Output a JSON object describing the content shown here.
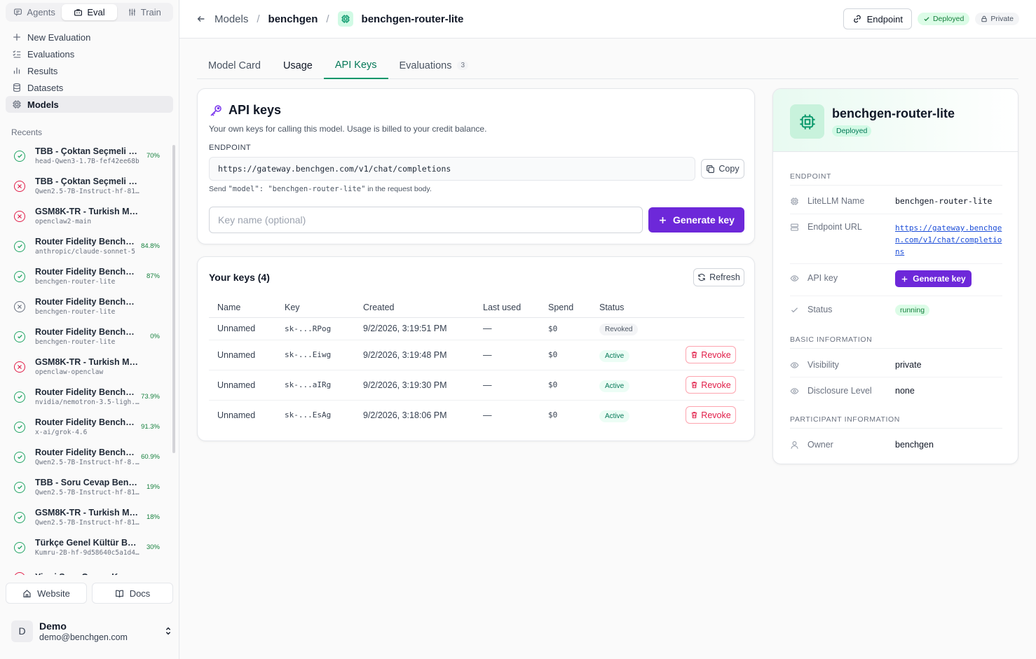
{
  "sidebar": {
    "modes": [
      {
        "label": "Agents",
        "icon": "chat-icon"
      },
      {
        "label": "Eval",
        "icon": "briefcase-icon",
        "active": true
      },
      {
        "label": "Train",
        "icon": "sliders-icon"
      }
    ],
    "nav": [
      {
        "label": "New Evaluation",
        "icon": "plus-icon"
      },
      {
        "label": "Evaluations",
        "icon": "list-check-icon"
      },
      {
        "label": "Results",
        "icon": "bar-chart-icon"
      },
      {
        "label": "Datasets",
        "icon": "database-icon"
      },
      {
        "label": "Models",
        "icon": "chip-icon",
        "active": true
      }
    ],
    "recents_title": "Recents",
    "recents": [
      {
        "name": "TBB - Çoktan Seçmeli Be...",
        "sub": "head-Qwen3-1.7B-fef42ee68b",
        "score": "70%",
        "status": "success"
      },
      {
        "name": "TBB - Çoktan Seçmeli Benchm...",
        "sub": "Qwen2.5-7B-Instruct-hf-8116f9e5...",
        "score": "",
        "status": "error"
      },
      {
        "name": "GSM8K-TR - Turkish Math Rea...",
        "sub": "openclaw2-main",
        "score": "",
        "status": "error"
      },
      {
        "name": "Router Fidelity Benchm...",
        "sub": "anthropic/claude-sonnet-5",
        "score": "84.8%",
        "status": "success"
      },
      {
        "name": "Router Fidelity Benchmark",
        "sub": "benchgen-router-lite",
        "score": "87%",
        "status": "success"
      },
      {
        "name": "Router Fidelity Benchmark",
        "sub": "benchgen-router-lite",
        "score": "",
        "status": "cancel"
      },
      {
        "name": "Router Fidelity Benchmark",
        "sub": "benchgen-router-lite",
        "score": "0%",
        "status": "success"
      },
      {
        "name": "GSM8K-TR - Turkish Math Rea...",
        "sub": "openclaw-openclaw",
        "score": "",
        "status": "error"
      },
      {
        "name": "Router Fidelity Benchm...",
        "sub": "nvidia/nemotron-3.5-ligh...",
        "score": "73.9%",
        "status": "success"
      },
      {
        "name": "Router Fidelity Benchm...",
        "sub": "x-ai/grok-4.6",
        "score": "91.3%",
        "status": "success"
      },
      {
        "name": "Router Fidelity Benchm...",
        "sub": "Qwen2.5-7B-Instruct-hf-8...",
        "score": "60.9%",
        "status": "success"
      },
      {
        "name": "TBB - Soru Cevap Bench...",
        "sub": "Qwen2.5-7B-Instruct-hf-811...",
        "score": "19%",
        "status": "success"
      },
      {
        "name": "GSM8K-TR - Turkish Mat...",
        "sub": "Qwen2.5-7B-Instruct-hf-811...",
        "score": "18%",
        "status": "success"
      },
      {
        "name": "Türkçe Genel Kültür Benc...",
        "sub": "Kumru-2B-hf-9d58640c5a1d4...",
        "score": "30%",
        "status": "success"
      },
      {
        "name": "Yirmi Soru Oyunu Kıyaslaması",
        "sub": "",
        "score": "",
        "status": "error"
      }
    ],
    "website_label": "Website",
    "docs_label": "Docs",
    "user": {
      "initial": "D",
      "name": "Demo",
      "email": "demo@benchgen.com"
    }
  },
  "header": {
    "back_label": "Models",
    "crumb_org": "benchgen",
    "crumb_model": "benchgen-router-lite",
    "endpoint_label": "Endpoint",
    "deployed_label": "Deployed",
    "private_label": "Private"
  },
  "tabs": [
    {
      "label": "Model Card",
      "count": ""
    },
    {
      "label": "Usage",
      "count": ""
    },
    {
      "label": "API Keys",
      "count": "",
      "active": true
    },
    {
      "label": "Evaluations",
      "count": "3"
    }
  ],
  "api_card": {
    "title": "API keys",
    "description": "Your own keys for calling this model. Usage is billed to your credit balance.",
    "endpoint_label": "ENDPOINT",
    "endpoint_url": "https://gateway.benchgen.com/v1/chat/completions",
    "copy_label": "Copy",
    "hint_prefix": "Send ",
    "hint_code": "\"model\": \"benchgen-router-lite\"",
    "hint_suffix": " in the request body.",
    "keyname_placeholder": "Key name (optional)",
    "generate_label": "Generate key"
  },
  "keys_card": {
    "title": "Your keys (4)",
    "refresh_label": "Refresh",
    "columns": [
      "Name",
      "Key",
      "Created",
      "Last used",
      "Spend",
      "Status"
    ],
    "rows": [
      {
        "name": "Unnamed",
        "key": "sk-...RPog",
        "created": "9/2/2026, 3:19:51 PM",
        "last_used": "—",
        "spend": "$0",
        "status": "Revoked",
        "action": ""
      },
      {
        "name": "Unnamed",
        "key": "sk-...Eiwg",
        "created": "9/2/2026, 3:19:48 PM",
        "last_used": "—",
        "spend": "$0",
        "status": "Active",
        "action": "Revoke"
      },
      {
        "name": "Unnamed",
        "key": "sk-...aIRg",
        "created": "9/2/2026, 3:19:30 PM",
        "last_used": "—",
        "spend": "$0",
        "status": "Active",
        "action": "Revoke"
      },
      {
        "name": "Unnamed",
        "key": "sk-...EsAg",
        "created": "9/2/2026, 3:18:06 PM",
        "last_used": "—",
        "spend": "$0",
        "status": "Active",
        "action": "Revoke"
      }
    ]
  },
  "info_card": {
    "title": "benchgen-router-lite",
    "badge": "Deployed",
    "endpoint_section": "ENDPOINT",
    "litellm_label": "LiteLLM Name",
    "litellm_value": "benchgen-router-lite",
    "endpoint_url_label": "Endpoint URL",
    "endpoint_url_value": "https://gateway.benchgen.com/v1/chat/completions",
    "api_key_label": "API key",
    "api_key_button": "Generate key",
    "status_label": "Status",
    "status_value": "running",
    "basic_section": "BASIC INFORMATION",
    "visibility_label": "Visibility",
    "visibility_value": "private",
    "disclosure_label": "Disclosure Level",
    "disclosure_value": "none",
    "participant_section": "PARTICIPANT INFORMATION",
    "owner_label": "Owner",
    "owner_value": "benchgen"
  }
}
